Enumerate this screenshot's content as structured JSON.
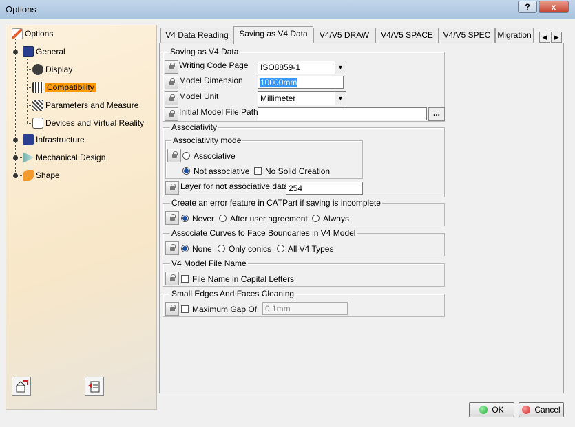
{
  "window": {
    "title": "Options",
    "help_label": "?",
    "close_label": "x"
  },
  "tree": {
    "root": "Options",
    "items": [
      {
        "label": "General"
      },
      {
        "label": "Display"
      },
      {
        "label": "Compatibility"
      },
      {
        "label": "Parameters and Measure"
      },
      {
        "label": "Devices and Virtual Reality"
      },
      {
        "label": "Infrastructure"
      },
      {
        "label": "Mechanical Design"
      },
      {
        "label": "Shape"
      }
    ]
  },
  "tabs": [
    "V4 Data Reading",
    "Saving as V4 Data",
    "V4/V5 DRAW",
    "V4/V5 SPACE",
    "V4/V5 SPEC",
    "Migration"
  ],
  "tab_scroll": {
    "left": "◀",
    "right": "▶"
  },
  "saving": {
    "title": "Saving as V4 Data",
    "writing_code_page_label": "Writing Code Page",
    "writing_code_page_value": "ISO8859-1",
    "model_dimension_label": "Model Dimension",
    "model_dimension_value": "10000mm",
    "model_unit_label": "Model Unit",
    "model_unit_value": "Millimeter",
    "initial_path_label": "Initial Model File Path",
    "initial_path_value": "",
    "browse_label": "..."
  },
  "assoc": {
    "title": "Associativity",
    "mode_title": "Associativity mode",
    "associative": "Associative",
    "not_associative": "Not associative",
    "no_solid": "No Solid Creation",
    "layer_label": "Layer for not associative data",
    "layer_value": "254"
  },
  "error_feature": {
    "title": "Create an error feature in CATPart if saving is incomplete",
    "never": "Never",
    "after": "After user agreement",
    "always": "Always"
  },
  "curves": {
    "title": "Associate Curves to Face Boundaries in V4 Model",
    "none": "None",
    "conics": "Only conics",
    "all": "All V4 Types"
  },
  "filename": {
    "title": "V4 Model File Name",
    "capital": "File Name in Capital Letters"
  },
  "cleaning": {
    "title": "Small Edges And Faces Cleaning",
    "max_gap": "Maximum Gap Of",
    "max_gap_value": "0,1mm"
  },
  "footer": {
    "ok": "OK",
    "cancel": "Cancel"
  },
  "colors": {
    "selection": "#ff9a00",
    "ok_dot": "#22a83a",
    "cancel_dot": "#d62020"
  }
}
